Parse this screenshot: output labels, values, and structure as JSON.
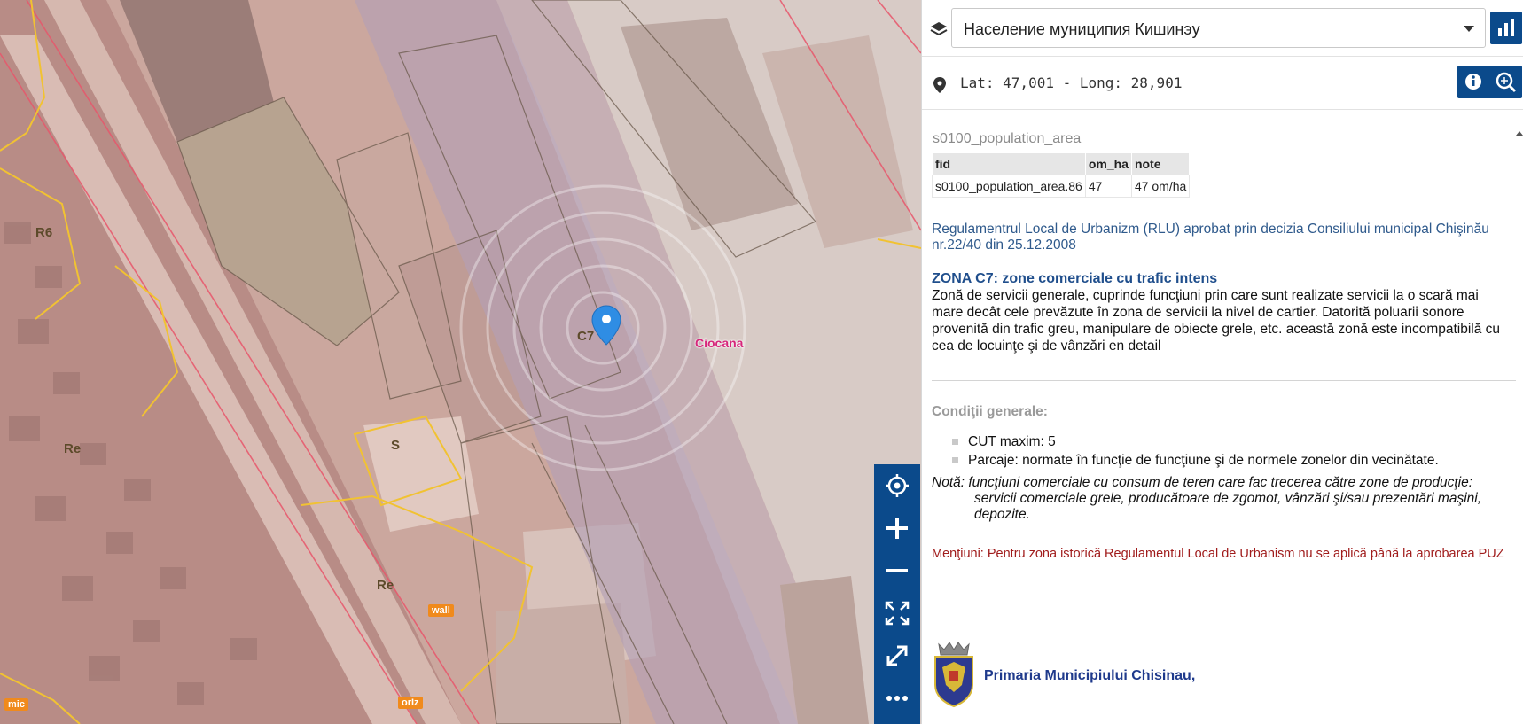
{
  "map": {
    "zone_labels": [
      "C7",
      "R6",
      "Re",
      "S",
      "Re"
    ],
    "district_label": "Ciocana",
    "tags": [
      "wall",
      "orIz",
      "mic"
    ],
    "tools": [
      {
        "name": "locate-icon"
      },
      {
        "name": "zoom-in-icon"
      },
      {
        "name": "zoom-out-icon"
      },
      {
        "name": "fit-extent-icon"
      },
      {
        "name": "fullscreen-icon"
      },
      {
        "name": "more-icon"
      }
    ]
  },
  "panel": {
    "layer_select": {
      "value": "Население муниципия Кишинэу"
    },
    "coords": "Lat: 47,001 - Long: 28,901",
    "feature": {
      "dataset": "s0100_population_area",
      "columns": [
        "fid",
        "om_ha",
        "note"
      ],
      "rows": [
        [
          "s0100_population_area.86",
          "47",
          "47 om/ha"
        ]
      ]
    },
    "rlu_text": "Regulamentrul Local de Urbanizm (RLU) aprobat prin decizia Consiliului municipal Chişinău nr.22/40 din 25.12.2008",
    "zona_title": "ZONA C7: zone comerciale cu trafic intens",
    "zona_desc": "Zonă de servicii generale, cuprinde funcţiuni prin care sunt realizate servicii la o scară mai mare decât cele prevăzute în zona de servicii la nivel de cartier. Datorită poluarii sonore provenită din trafic greu, manipulare de obiecte grele, etc. această zonă este incompatibilă cu cea de locuinţe şi de vânzări en detail",
    "conditions_title": "Condiţii generale:",
    "conditions": [
      "CUT maxim: 5",
      "Parcaje: normate în funcţie de funcţiune şi de normele zonelor din vecinătate."
    ],
    "note_label": "Notă:",
    "note_text_1": "funcţiuni comerciale cu consum de teren care fac trecerea către zone de producţie:",
    "note_text_2": "servicii comerciale grele, producătoare de zgomot, vânzări şi/sau prezentări maşini, depozite.",
    "mentiuni": "Menţiuni: Pentru zona istorică Regulamentul Local de Urbanism nu se aplică până la aprobarea PUZ",
    "footer_name": "Primaria Municipiului Chisinau,"
  },
  "colors": {
    "accent": "#0b4a8b",
    "zone_outline": "#f1c232",
    "district_label": "#d6267b",
    "mentiuni": "#a01c1c"
  }
}
